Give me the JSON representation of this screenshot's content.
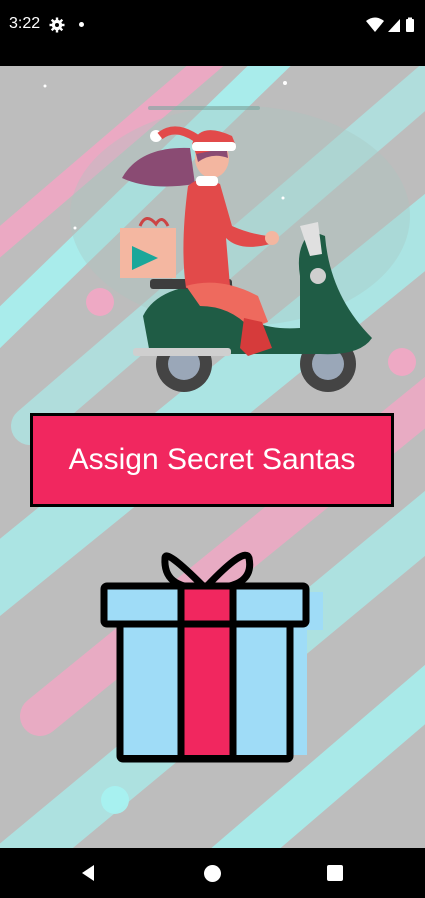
{
  "status_bar": {
    "time": "3:22",
    "icons": [
      "gear-icon",
      "notification-dot-icon",
      "wifi-icon",
      "signal-icon",
      "battery-icon"
    ]
  },
  "main": {
    "illustration": "santa-girl-on-scooter",
    "assign_button_label": "Assign Secret Santas",
    "gift_image": "gift-box"
  },
  "nav_bar": {
    "icons": [
      "back-icon",
      "home-icon",
      "recents-icon"
    ]
  },
  "colors": {
    "accent": "#f1275f",
    "background": "#bdbdbd",
    "scooter": "#1f5c45",
    "gift_body": "#9fdcf7"
  }
}
